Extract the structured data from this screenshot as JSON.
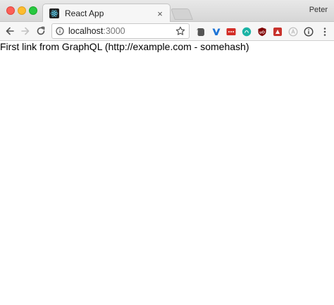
{
  "browser": {
    "tab": {
      "title": "React App",
      "close_glyph": "×",
      "favicon": "react-icon"
    },
    "profile_name": "Peter",
    "address_bar": {
      "host": "localhost",
      "port": ":3000"
    },
    "extensions": [
      "evernote-icon",
      "v-extension-icon",
      "lastpass-icon",
      "teal-circle-extension-icon",
      "ublock-icon",
      "red-extension-icon",
      "grey-circle-extension-icon",
      "info-extension-icon",
      "menu-icon"
    ]
  },
  "page": {
    "text": "First link from GraphQL (http://example.com - somehash)"
  }
}
